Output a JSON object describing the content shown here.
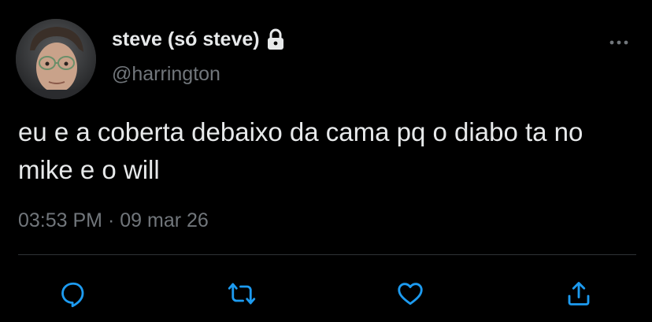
{
  "tweet": {
    "author": {
      "display_name": "steve (só steve)",
      "handle": "@harrington",
      "protected_icon": "lock-icon",
      "avatar_icon": "user-avatar"
    },
    "text": "eu e a coberta debaixo da cama pq o diabo ta no mike e o will",
    "time": "03:53 PM",
    "separator": "·",
    "date": "09 mar 26",
    "more_icon": "more-horizontal-icon",
    "actions": [
      {
        "name": "reply",
        "icon": "reply-icon"
      },
      {
        "name": "retweet",
        "icon": "retweet-icon"
      },
      {
        "name": "like",
        "icon": "heart-icon"
      },
      {
        "name": "share",
        "icon": "share-icon"
      }
    ]
  },
  "colors": {
    "background": "#000000",
    "primary_text": "#e7e9ea",
    "secondary_text": "#71767b",
    "icon": "#1d9bf0",
    "divider": "#2f3336"
  }
}
